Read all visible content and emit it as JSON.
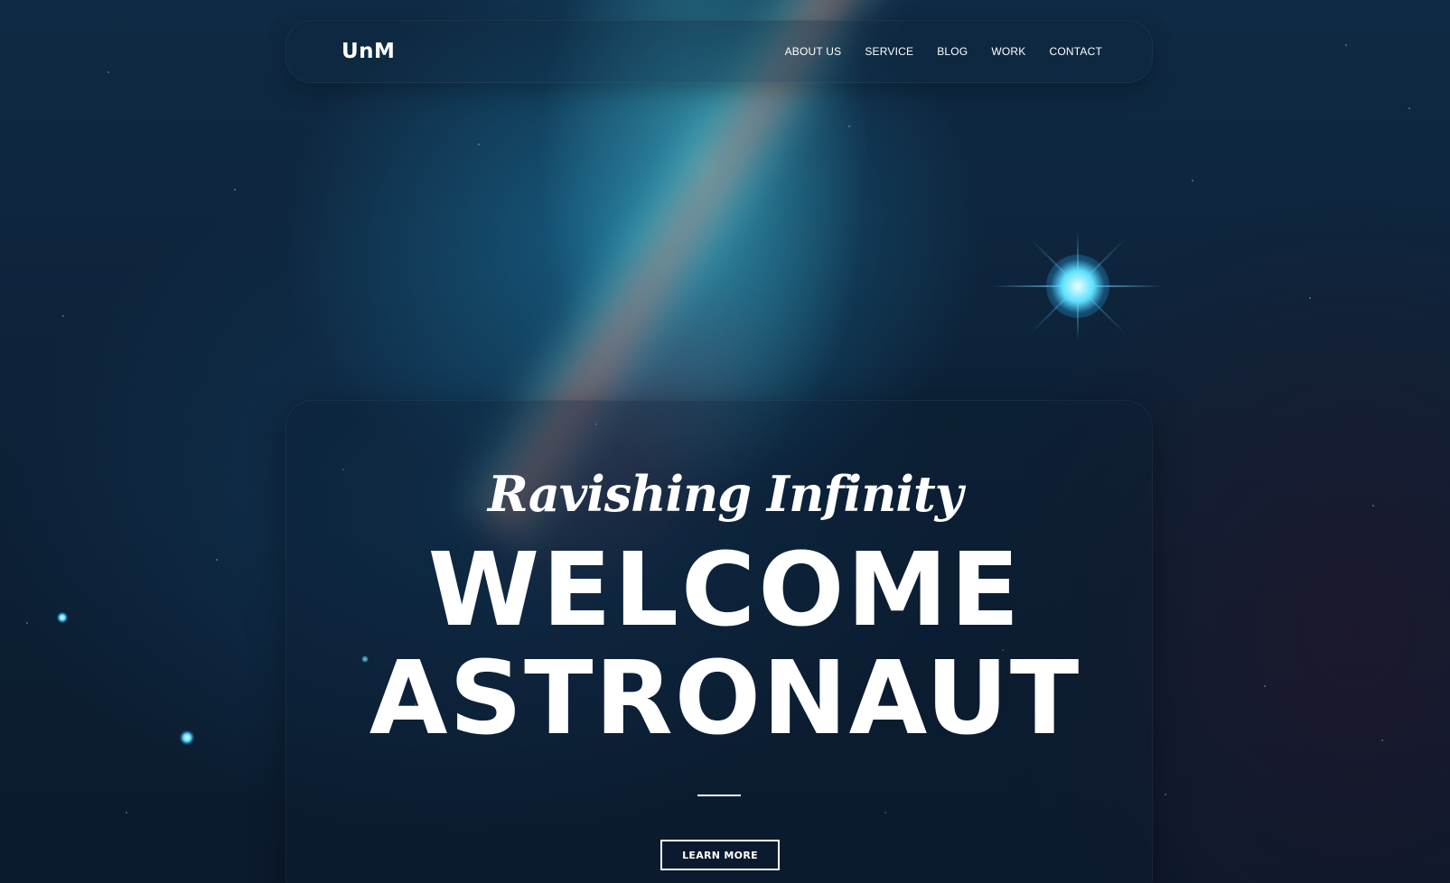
{
  "colors": {
    "accent": "#ffffff",
    "background": "#0d2238",
    "star_glow": "#5fe0ff"
  },
  "navbar": {
    "logo": "UnM",
    "links": [
      {
        "label": "ABOUT US"
      },
      {
        "label": "SERVICE"
      },
      {
        "label": "BLOG"
      },
      {
        "label": "WORK"
      },
      {
        "label": "CONTACT"
      }
    ]
  },
  "hero": {
    "tagline": "Ravishing Infinity",
    "title_line1": "WELCOME",
    "title_line2": "ASTRONAUT",
    "cta_label": "LEARN MORE"
  }
}
